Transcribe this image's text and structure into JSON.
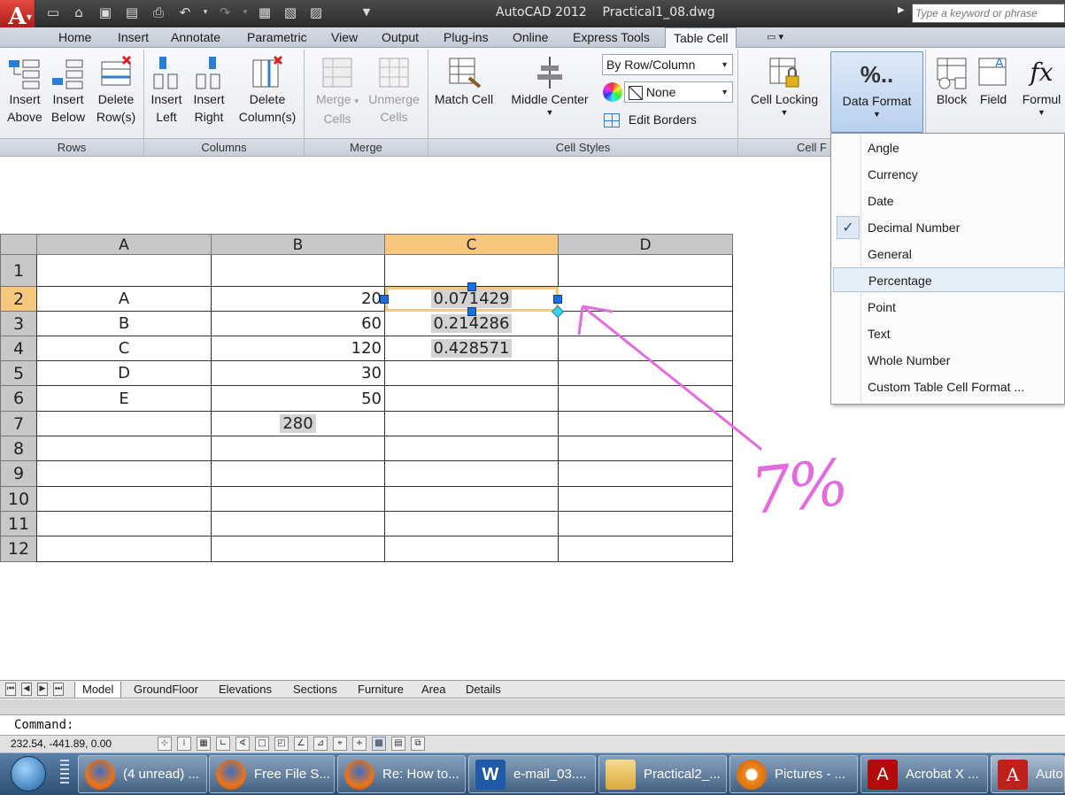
{
  "title": {
    "app": "AutoCAD 2012",
    "file": "Practical1_08.dwg",
    "full": "AutoCAD 2012    Practical1_08.dwg"
  },
  "search": {
    "placeholder": "Type a keyword or phrase"
  },
  "tabs": [
    "Home",
    "Insert",
    "Annotate",
    "Parametric",
    "View",
    "Output",
    "Plug-ins",
    "Online",
    "Express Tools",
    "Table Cell"
  ],
  "ribbon": {
    "rows": {
      "title": "Rows",
      "insert_above": [
        "Insert",
        "Above"
      ],
      "insert_below": [
        "Insert",
        "Below"
      ],
      "delete_rows": [
        "Delete",
        "Row(s)"
      ]
    },
    "columns": {
      "title": "Columns",
      "insert_left": [
        "Insert",
        "Left"
      ],
      "insert_right": [
        "Insert",
        "Right"
      ],
      "delete_columns": [
        "Delete",
        "Column(s)"
      ]
    },
    "merge": {
      "title": "Merge",
      "merge_cells": [
        "Merge",
        "Cells"
      ],
      "unmerge_cells": [
        "Unmerge",
        "Cells"
      ]
    },
    "cell_styles": {
      "title": "Cell Styles",
      "match_cell": "Match Cell",
      "alignment": "Middle Center",
      "by_row_column": "By Row/Column",
      "fill": "None",
      "edit_borders": "Edit Borders"
    },
    "cell_format": {
      "title": "Cell F",
      "cell_locking": "Cell Locking",
      "data_format": "Data Format",
      "data_format_icon": "%.."
    },
    "insert": {
      "block": "Block",
      "field": "Field",
      "formula": "Formul"
    }
  },
  "table": {
    "columns": [
      "A",
      "B",
      "C",
      "D"
    ],
    "rows": [
      {
        "n": "1",
        "a": "",
        "b": "",
        "c": "",
        "d": ""
      },
      {
        "n": "2",
        "a": "A",
        "b": "20",
        "c": "0.071429",
        "d": ""
      },
      {
        "n": "3",
        "a": "B",
        "b": "60",
        "c": "0.214286",
        "d": ""
      },
      {
        "n": "4",
        "a": "C",
        "b": "120",
        "c": "0.428571",
        "d": ""
      },
      {
        "n": "5",
        "a": "D",
        "b": "30",
        "c": "",
        "d": ""
      },
      {
        "n": "6",
        "a": "E",
        "b": "50",
        "c": "",
        "d": ""
      },
      {
        "n": "7",
        "a": "",
        "b": "280",
        "c": "",
        "d": ""
      },
      {
        "n": "8",
        "a": "",
        "b": "",
        "c": "",
        "d": ""
      },
      {
        "n": "9",
        "a": "",
        "b": "",
        "c": "",
        "d": ""
      },
      {
        "n": "10",
        "a": "",
        "b": "",
        "c": "",
        "d": ""
      },
      {
        "n": "11",
        "a": "",
        "b": "",
        "c": "",
        "d": ""
      },
      {
        "n": "12",
        "a": "",
        "b": "",
        "c": "",
        "d": ""
      }
    ],
    "selected_column": "C",
    "selected_row": "2"
  },
  "data_format_menu": {
    "items": [
      "Angle",
      "Currency",
      "Date",
      "Decimal Number",
      "General",
      "Percentage",
      "Point",
      "Text",
      "Whole Number",
      "Custom Table Cell Format ..."
    ],
    "checked": "Decimal Number",
    "hovered": "Percentage"
  },
  "annotation": {
    "text": "7%",
    "color": "#e46ae0"
  },
  "layout_tabs": [
    "Model",
    "GroundFloor",
    "Elevations",
    "Sections",
    "Furniture",
    "Area",
    "Details"
  ],
  "command": {
    "prompt": "Command:"
  },
  "status": {
    "coords": "232.54, -441.89, 0.00"
  },
  "taskbar": {
    "items": [
      "(4 unread) ...",
      "Free File S...",
      "Re: How to...",
      "e-mail_03....",
      "Practical2_...",
      "Pictures - ...",
      "Acrobat X ...",
      "Auto"
    ]
  },
  "colors": {
    "accent_selected": "#f7c77d",
    "ribbon_active": "#cfe0f5",
    "grip": "#1b6fe0"
  }
}
